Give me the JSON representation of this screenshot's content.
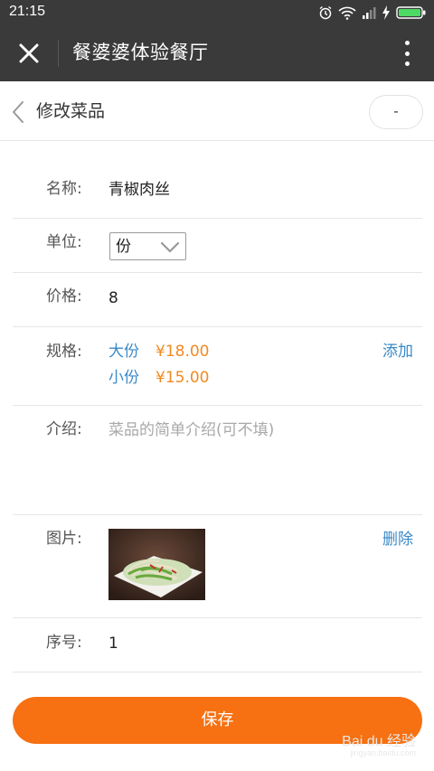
{
  "status_bar": {
    "time": "21:15",
    "icons": [
      "alarm-icon",
      "wifi-icon",
      "signal-icon",
      "charging-icon",
      "battery-icon"
    ]
  },
  "title_bar": {
    "title": "餐婆婆体验餐厅",
    "close_icon": "close-icon",
    "menu_icon": "more-vertical-icon"
  },
  "sub_header": {
    "title": "修改菜品",
    "pill_label": "-"
  },
  "form": {
    "name": {
      "label": "名称:",
      "value": "青椒肉丝"
    },
    "unit": {
      "label": "单位:",
      "value": "份"
    },
    "price": {
      "label": "价格:",
      "value": "8"
    },
    "spec": {
      "label": "规格:",
      "items": [
        {
          "name": "大份",
          "price": "¥18.00"
        },
        {
          "name": "小份",
          "price": "¥15.00"
        }
      ],
      "add_label": "添加"
    },
    "intro": {
      "label": "介绍:",
      "placeholder": "菜品的简单介绍(可不填)"
    },
    "image": {
      "label": "图片:",
      "delete_label": "删除"
    },
    "order": {
      "label": "序号:",
      "value": "1"
    }
  },
  "save_label": "保存",
  "watermark": {
    "brand": "Bai du 经验",
    "url": "jingyan.baidu.com"
  },
  "colors": {
    "header_bg": "#3a3a3a",
    "link_blue": "#3a8ac8",
    "price_orange": "#f08a22",
    "save_orange": "#f77011"
  }
}
